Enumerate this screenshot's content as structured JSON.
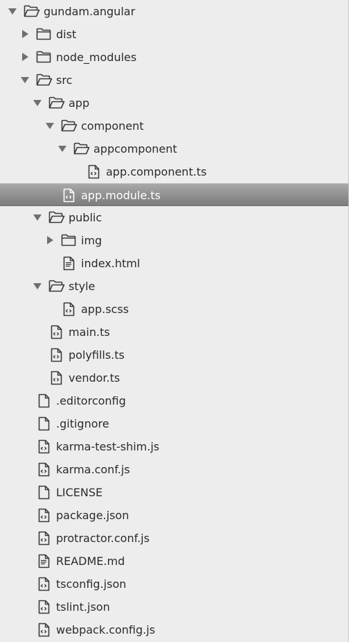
{
  "tree": [
    {
      "label": "gundam.angular",
      "depth": 0,
      "kind": "folder",
      "expanded": true
    },
    {
      "label": "dist",
      "depth": 1,
      "kind": "folder",
      "expanded": false
    },
    {
      "label": "node_modules",
      "depth": 1,
      "kind": "folder",
      "expanded": false
    },
    {
      "label": "src",
      "depth": 1,
      "kind": "folder",
      "expanded": true
    },
    {
      "label": "app",
      "depth": 2,
      "kind": "folder",
      "expanded": true
    },
    {
      "label": "component",
      "depth": 3,
      "kind": "folder",
      "expanded": true
    },
    {
      "label": "appcomponent",
      "depth": 4,
      "kind": "folder",
      "expanded": true
    },
    {
      "label": "app.component.ts",
      "depth": 5,
      "kind": "code-file"
    },
    {
      "label": "app.module.ts",
      "depth": 3,
      "kind": "code-file",
      "selected": true
    },
    {
      "label": "public",
      "depth": 2,
      "kind": "folder",
      "expanded": true
    },
    {
      "label": "img",
      "depth": 3,
      "kind": "folder",
      "expanded": false
    },
    {
      "label": "index.html",
      "depth": 3,
      "kind": "text-file"
    },
    {
      "label": "style",
      "depth": 2,
      "kind": "folder",
      "expanded": true
    },
    {
      "label": "app.scss",
      "depth": 3,
      "kind": "code-file"
    },
    {
      "label": "main.ts",
      "depth": 2,
      "kind": "code-file"
    },
    {
      "label": "polyfills.ts",
      "depth": 2,
      "kind": "code-file"
    },
    {
      "label": "vendor.ts",
      "depth": 2,
      "kind": "code-file"
    },
    {
      "label": ".editorconfig",
      "depth": 1,
      "kind": "plain-file"
    },
    {
      "label": ".gitignore",
      "depth": 1,
      "kind": "plain-file"
    },
    {
      "label": "karma-test-shim.js",
      "depth": 1,
      "kind": "code-file"
    },
    {
      "label": "karma.conf.js",
      "depth": 1,
      "kind": "code-file"
    },
    {
      "label": "LICENSE",
      "depth": 1,
      "kind": "plain-file"
    },
    {
      "label": "package.json",
      "depth": 1,
      "kind": "code-file"
    },
    {
      "label": "protractor.conf.js",
      "depth": 1,
      "kind": "code-file"
    },
    {
      "label": "README.md",
      "depth": 1,
      "kind": "text-file"
    },
    {
      "label": "tsconfig.json",
      "depth": 1,
      "kind": "code-file"
    },
    {
      "label": "tslint.json",
      "depth": 1,
      "kind": "code-file"
    },
    {
      "label": "webpack.config.js",
      "depth": 1,
      "kind": "code-file"
    }
  ],
  "colors": {
    "background": "#ededed",
    "text": "#2b2b2b",
    "icon": "#3a3a3a",
    "arrow": "#6f6f6f",
    "selected_text": "#ffffff"
  }
}
